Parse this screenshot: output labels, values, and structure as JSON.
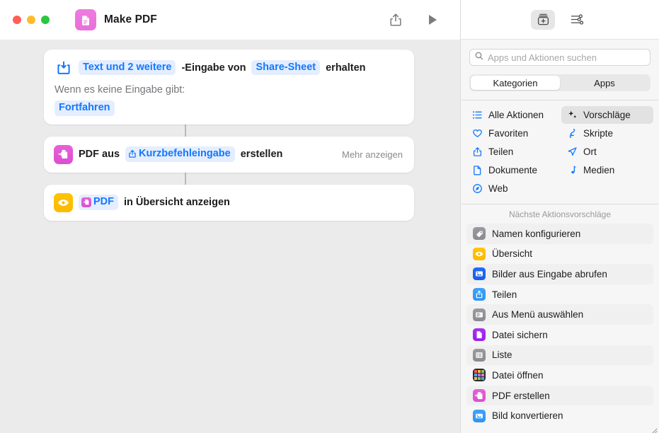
{
  "window": {
    "title": "Make PDF",
    "doc_icon": "pdf-document-icon",
    "traffic_lights": [
      "close",
      "minimize",
      "maximize"
    ],
    "toolbar": [
      {
        "name": "share-icon",
        "label": "Teilen"
      },
      {
        "name": "play-icon",
        "label": "Ausführen"
      }
    ]
  },
  "workflow": {
    "actions": [
      {
        "icon": "receive-input-icon",
        "icon_style": "plain",
        "segments": [
          {
            "type": "pill",
            "text": "Text und 2 weitere"
          },
          {
            "type": "text",
            "text": "-Eingabe von"
          },
          {
            "type": "pill",
            "text": "Share-Sheet"
          },
          {
            "type": "text",
            "text": "erhalten"
          }
        ],
        "sub_label": "Wenn es keine Eingabe gibt:",
        "sub_pill": "Fortfahren",
        "more_label": ""
      },
      {
        "icon": "make-pdf-icon",
        "icon_style": "magenta",
        "segments": [
          {
            "type": "text",
            "text": "PDF aus"
          },
          {
            "type": "pill-glyph",
            "text": "Kurzbefehleingabe",
            "glyph": "share-glyph"
          },
          {
            "type": "text",
            "text": "erstellen"
          }
        ],
        "sub_label": "",
        "sub_pill": "",
        "more_label": "Mehr anzeigen"
      },
      {
        "icon": "quick-look-eye-icon",
        "icon_style": "amber",
        "segments": [
          {
            "type": "pill-mini",
            "text": "PDF",
            "mini_icon": "pdf-mini-icon"
          },
          {
            "type": "text",
            "text": "in Übersicht anzeigen"
          }
        ],
        "sub_label": "",
        "sub_pill": "",
        "more_label": ""
      }
    ]
  },
  "sidebar": {
    "toolbar_buttons": [
      {
        "name": "action-library-icon",
        "active": true
      },
      {
        "name": "sliders-settings-icon",
        "active": false
      }
    ],
    "search": {
      "placeholder": "Apps und Aktionen suchen",
      "value": "",
      "icon": "search-icon"
    },
    "segments": [
      {
        "label": "Kategorien",
        "selected": true
      },
      {
        "label": "Apps",
        "selected": false
      }
    ],
    "categories": [
      {
        "label": "Alle Aktionen",
        "icon": "list-bullet-icon",
        "selected": false
      },
      {
        "label": "Vorschläge",
        "icon": "sparkles-icon",
        "selected": true
      },
      {
        "label": "Favoriten",
        "icon": "heart-icon",
        "selected": false
      },
      {
        "label": "Skripte",
        "icon": "script-icon",
        "selected": false
      },
      {
        "label": "Teilen",
        "icon": "share-icon",
        "selected": false
      },
      {
        "label": "Ort",
        "icon": "location-arrow-icon",
        "selected": false
      },
      {
        "label": "Dokumente",
        "icon": "document-icon",
        "selected": false
      },
      {
        "label": "Medien",
        "icon": "music-note-icon",
        "selected": false
      },
      {
        "label": "Web",
        "icon": "safari-compass-icon",
        "selected": false
      }
    ],
    "suggestions_header": "Nächste Aktionsvorschläge",
    "suggestions": [
      {
        "label": "Namen konfigurieren",
        "icon": "tag-icon",
        "color": "ic-gray"
      },
      {
        "label": "Übersicht",
        "icon": "eye-icon",
        "color": "ic-amber"
      },
      {
        "label": "Bilder aus Eingabe abrufen",
        "icon": "photo-icon",
        "color": "ic-blue-d"
      },
      {
        "label": "Teilen",
        "icon": "share-icon",
        "color": "ic-blue-l"
      },
      {
        "label": "Aus Menü auswählen",
        "icon": "menu-window-icon",
        "color": "ic-gray"
      },
      {
        "label": "Datei sichern",
        "icon": "file-save-icon",
        "color": "ic-purple"
      },
      {
        "label": "Liste",
        "icon": "list-icon",
        "color": "ic-gray"
      },
      {
        "label": "Datei öffnen",
        "icon": "finder-grid-icon",
        "color": "ic-finder"
      },
      {
        "label": "PDF erstellen",
        "icon": "pdf-icon",
        "color": "ic-magenta"
      },
      {
        "label": "Bild konvertieren",
        "icon": "image-convert-icon",
        "color": "ic-blue-l"
      }
    ]
  },
  "colors": {
    "accent_blue": "#1478ff",
    "pill_bg": "#e4eeff",
    "canvas_bg": "#ebebeb",
    "sidebar_bg": "#f6f6f6",
    "magenta": "#db4fd0",
    "amber": "#fcb900"
  }
}
